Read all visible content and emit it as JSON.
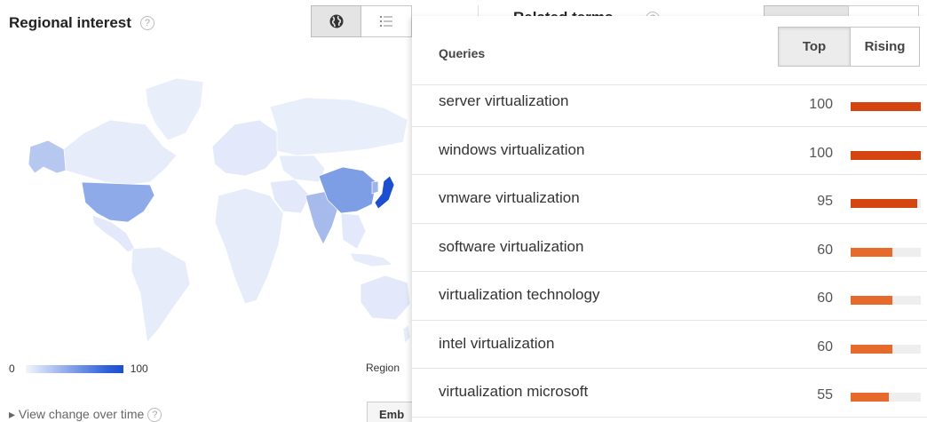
{
  "regional": {
    "title": "Regional interest",
    "help": "?",
    "legend_min": "0",
    "legend_max": "100",
    "region_label": "Region",
    "view_change": "▸ View change over time",
    "view_change_help": "?",
    "embed": "Emb",
    "accent_color": "#1b4fcf"
  },
  "background_panel": {
    "title": "Related terms",
    "help": "?",
    "top": "Top",
    "rising": "Rising"
  },
  "queries": {
    "heading": "Queries",
    "tab_top": "Top",
    "tab_rising": "Rising",
    "bar_color_high": "#d44512",
    "bar_color_mid": "#e56a2c",
    "rows": [
      {
        "label": "server virtualization",
        "value": 100
      },
      {
        "label": "windows virtualization",
        "value": 100
      },
      {
        "label": "vmware virtualization",
        "value": 95
      },
      {
        "label": "software virtualization",
        "value": 60
      },
      {
        "label": "virtualization technology",
        "value": 60
      },
      {
        "label": "intel virtualization",
        "value": 60
      },
      {
        "label": "virtualization microsoft",
        "value": 55
      }
    ]
  }
}
